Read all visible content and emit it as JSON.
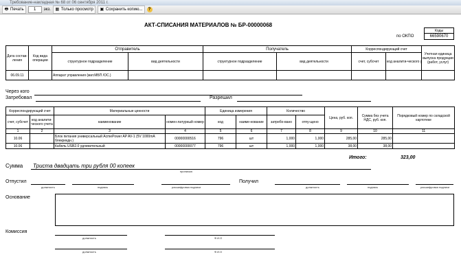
{
  "window": {
    "title": "Требование-накладная № 68 от 06 сентября 2011 г."
  },
  "toolbar": {
    "print_label": "Печать",
    "copies_value": "1",
    "copies_suffix": "экз.",
    "view_only_label": "Только просмотр",
    "save_copy_label": "Сохранить копию...",
    "help_label": "?"
  },
  "doc": {
    "title": "АКТ-СПИСАНИЯ МАТЕРИАЛОВ № БР-00000068",
    "codes_label": "Коды",
    "okpo_label": "по ОКПО",
    "okpo_value": "66590670",
    "header": {
      "date_label": "Дата состав-ления",
      "op_label": "Код вида операции",
      "sender_label": "Отправитель",
      "receiver_label": "Получатель",
      "corr_label": "Корреспондирующий счет",
      "unit_label": "Учетная единица выпуска продукции (работ, услуг)",
      "struct_label": "структурное подразделение",
      "activity_label": "вид деятельности",
      "account_label": "счет, субсчет",
      "analytic_label": "код аналити-ческого учета",
      "date_value": "06.09.11",
      "sender_value": "Аппарат управления (мат.МБП /ОС.)"
    },
    "through_label": "Через кого",
    "requested_label": "Затребовал",
    "allowed_label": "Разрешил",
    "items": {
      "corr_label": "Корреспондирующий счет",
      "values_label": "Материальные ценности",
      "unit_label": "Единица измерения",
      "qty_label": "Количество",
      "price_label": "Цена, руб. коп.",
      "sum_label": "Сумма без учета НДС, руб. коп.",
      "order_label": "Порядковый номер по складской картотеке",
      "account_label": "счет, субсчет",
      "analytic_label": "код аналити-ческого учета",
      "name_label": "наименование",
      "nomen_label": "номен-латурный номер",
      "code_label": "код",
      "unit_name_label": "наиме-нование",
      "requested_label": "затребо-вано",
      "released_label": "отпу-щено",
      "col_numbers": [
        "1",
        "2",
        "3",
        "4",
        "5",
        "6",
        "7",
        "8",
        "9",
        "10",
        "11"
      ],
      "rows": [
        {
          "account": "10.06",
          "analytic": "",
          "name": "Блок питания универсальный AcmePower AP AV-1 (5V 1000mA блекрекдн.)",
          "nomen": "00000000516",
          "code": "796",
          "unit": "шт",
          "requested": "1,000",
          "released": "1,000",
          "price": "285,00",
          "sum": "285,00",
          "order": ""
        },
        {
          "account": "10.06",
          "analytic": "",
          "name": "Кабель USB2.0 удлинительный",
          "nomen": "00000000077",
          "code": "796",
          "unit": "шт",
          "requested": "1,000",
          "released": "1,000",
          "price": "38,00",
          "sum": "38,00",
          "order": ""
        }
      ],
      "total_label": "Итого:",
      "total_value": "323,00"
    },
    "sum_label": "Сумма",
    "sum_value": "Триста двадцать три рубля 00 копеек",
    "sum_caption": "прописью",
    "released_by_label": "Отпустил",
    "received_by_label": "Получил",
    "cap_position": "должность",
    "cap_signature": "подпись",
    "cap_decoding": "расшифровка подписи",
    "basis_label": "Основание",
    "commission_label": "Комиссия",
    "cap_fio": "Ф.И.О"
  }
}
